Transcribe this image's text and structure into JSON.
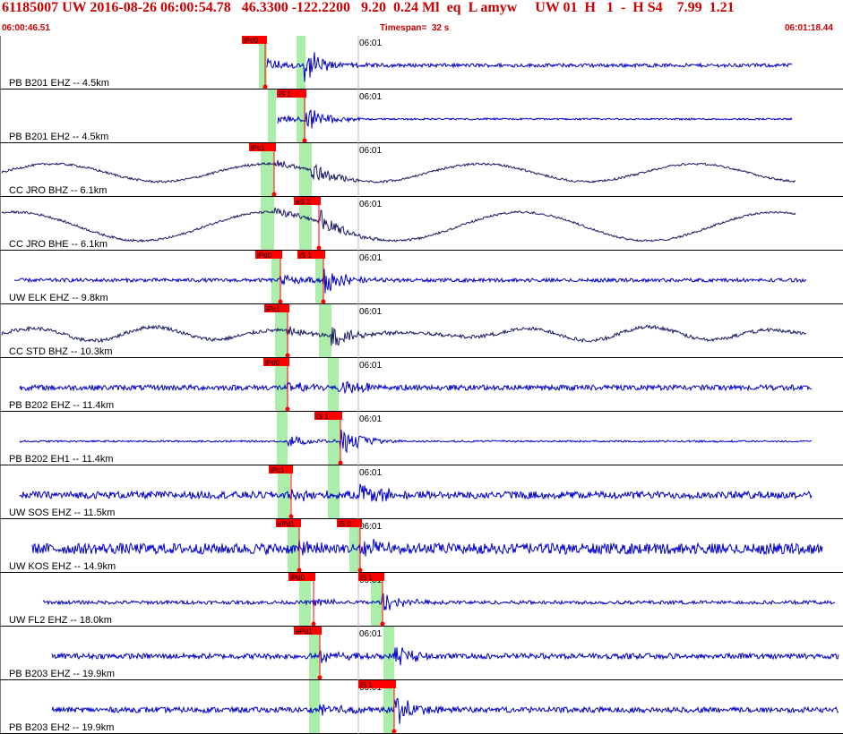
{
  "header": {
    "line1": "61185007 UW 2016-08-26 06:00:54.78   46.3300 -122.2200   9.20  0.24 Ml  eq  L amyw     UW 01  H   1  -  H S4    7.99  1.21",
    "start_time": "06:00:46.51",
    "timespan": "Timespan=  32 s",
    "end_time": "06:01:18.44"
  },
  "colors": {
    "blue_trace": "#0000cc",
    "navy_trace": "#1a1a66",
    "pick_red": "#ff0000",
    "window_green": "#aaeeaa",
    "header_red": "#cc0000"
  },
  "time_label": "06:01",
  "traces": [
    {
      "label": "PB B201 EHZ -- 4.5km",
      "p_pick": "iPd0",
      "s_pick": "",
      "color": "blue"
    },
    {
      "label": "PB B201 EH2 -- 4.5km",
      "p_pick": "",
      "s_pick": "iS 1",
      "color": "blue"
    },
    {
      "label": "CC JRO BHZ -- 6.1km",
      "p_pick": "iPc1",
      "s_pick": "",
      "color": "navy"
    },
    {
      "label": "CC JRO BHE -- 6.1km",
      "p_pick": "",
      "s_pick": "eS 2",
      "color": "navy"
    },
    {
      "label": "UW ELK EHZ -- 9.8km",
      "p_pick": "iPd0",
      "s_pick": "iS 1",
      "color": "blue"
    },
    {
      "label": "CC STD BHZ -- 10.3km",
      "p_pick": "iPc1",
      "s_pick": "",
      "color": "navy"
    },
    {
      "label": "PB B202 EHZ -- 11.4km",
      "p_pick": "iPd0",
      "s_pick": "",
      "color": "blue"
    },
    {
      "label": "PB B202 EH1 -- 11.4km",
      "p_pick": "",
      "s_pick": "iS 1",
      "color": "blue"
    },
    {
      "label": "UW SOS EHZ -- 11.5km",
      "p_pick": "iPc1",
      "s_pick": "",
      "color": "blue"
    },
    {
      "label": "UW KOS EHZ -- 14.9km",
      "p_pick": "ePd1",
      "s_pick": "iS 0",
      "color": "blue"
    },
    {
      "label": "UW FL2 EHZ -- 18.0km",
      "p_pick": "iPd0",
      "s_pick": "iS 1",
      "color": "blue"
    },
    {
      "label": "PB B203 EHZ -- 19.9km",
      "p_pick": "ePd1",
      "s_pick": "",
      "color": "blue"
    },
    {
      "label": "PB B203 EH2 -- 19.9km",
      "p_pick": "",
      "s_pick": "iS 1",
      "color": "blue"
    }
  ]
}
